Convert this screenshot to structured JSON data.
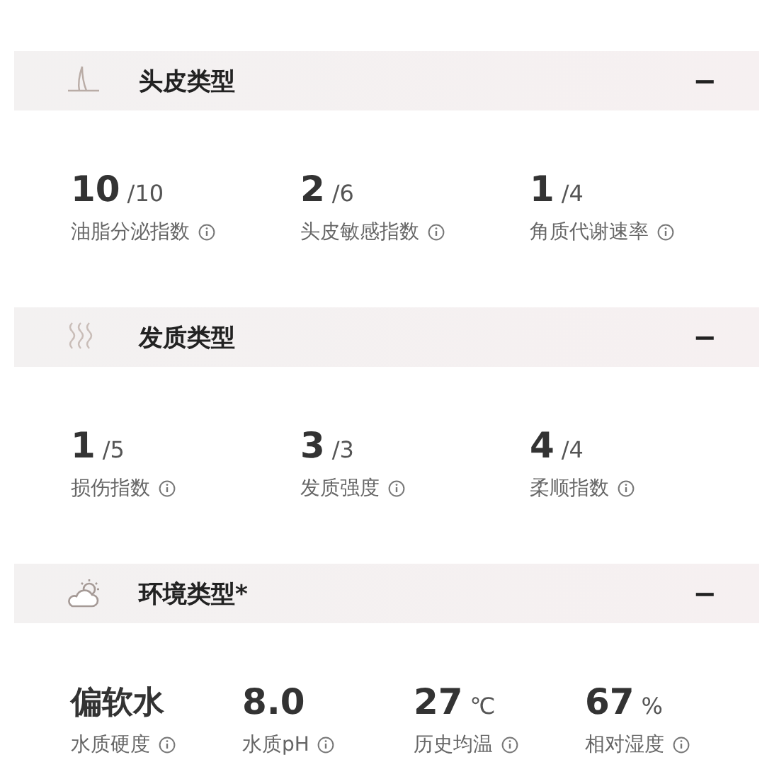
{
  "sections": [
    {
      "kind": "scalp",
      "title": "头皮类型",
      "toggle": "−",
      "metrics": [
        {
          "value": "10",
          "unit": "/10",
          "label": "油脂分泌指数"
        },
        {
          "value": "2",
          "unit": "/6",
          "label": "头皮敏感指数"
        },
        {
          "value": "1",
          "unit": "/4",
          "label": "角质代谢速率"
        }
      ]
    },
    {
      "kind": "hair",
      "title": "发质类型",
      "toggle": "−",
      "metrics": [
        {
          "value": "1",
          "unit": "/5",
          "label": "损伤指数"
        },
        {
          "value": "3",
          "unit": "/3",
          "label": "发质强度"
        },
        {
          "value": "4",
          "unit": "/4",
          "label": "柔顺指数"
        }
      ]
    },
    {
      "kind": "weather",
      "title": "环境类型*",
      "toggle": "−",
      "metrics": [
        {
          "value": "偏软水",
          "label": "水质硬度"
        },
        {
          "value": "8.0",
          "label": "水质pH"
        },
        {
          "value": "27",
          "unit": "℃",
          "label": "历史均温"
        },
        {
          "value": "67",
          "unit": "%",
          "label": "相对湿度"
        }
      ]
    }
  ]
}
